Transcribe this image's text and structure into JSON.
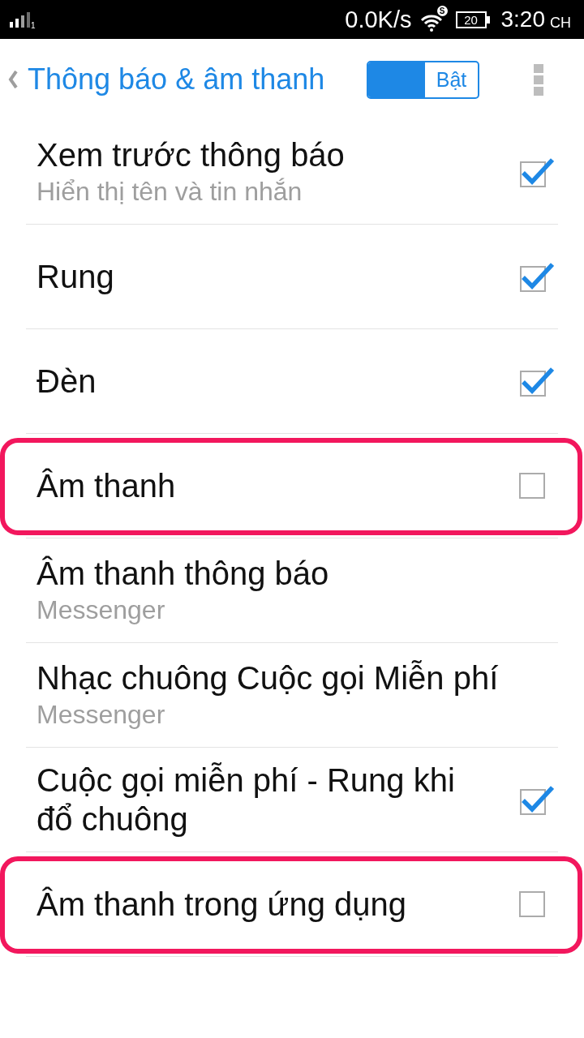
{
  "status_bar": {
    "sim_slot": "1",
    "network_speed": "0.0K/s",
    "wifi_badge": "S",
    "battery": "20",
    "time": "3:20",
    "time_suffix": "CH"
  },
  "header": {
    "title": "Thông báo & âm thanh",
    "toggle": {
      "label": "Bật",
      "on": true
    }
  },
  "settings": [
    {
      "kind": "checkbox",
      "title": "Xem trước thông báo",
      "subtitle": "Hiển thị tên và tin nhắn",
      "checked": true,
      "highlighted": false
    },
    {
      "kind": "checkbox",
      "title": "Rung",
      "checked": true,
      "highlighted": false
    },
    {
      "kind": "checkbox",
      "title": "Đèn",
      "checked": true,
      "highlighted": false
    },
    {
      "kind": "checkbox",
      "title": "Âm thanh",
      "checked": false,
      "highlighted": true
    },
    {
      "kind": "link",
      "title": "Âm thanh thông báo",
      "subtitle": "Messenger",
      "highlighted": false
    },
    {
      "kind": "link",
      "title": "Nhạc chuông Cuộc gọi Miễn phí",
      "subtitle": "Messenger",
      "highlighted": false
    },
    {
      "kind": "checkbox",
      "title": "Cuộc gọi miễn phí - Rung khi đổ chuông",
      "checked": true,
      "highlighted": false
    },
    {
      "kind": "checkbox",
      "title": "Âm thanh trong ứng dụng",
      "checked": false,
      "highlighted": true
    }
  ]
}
